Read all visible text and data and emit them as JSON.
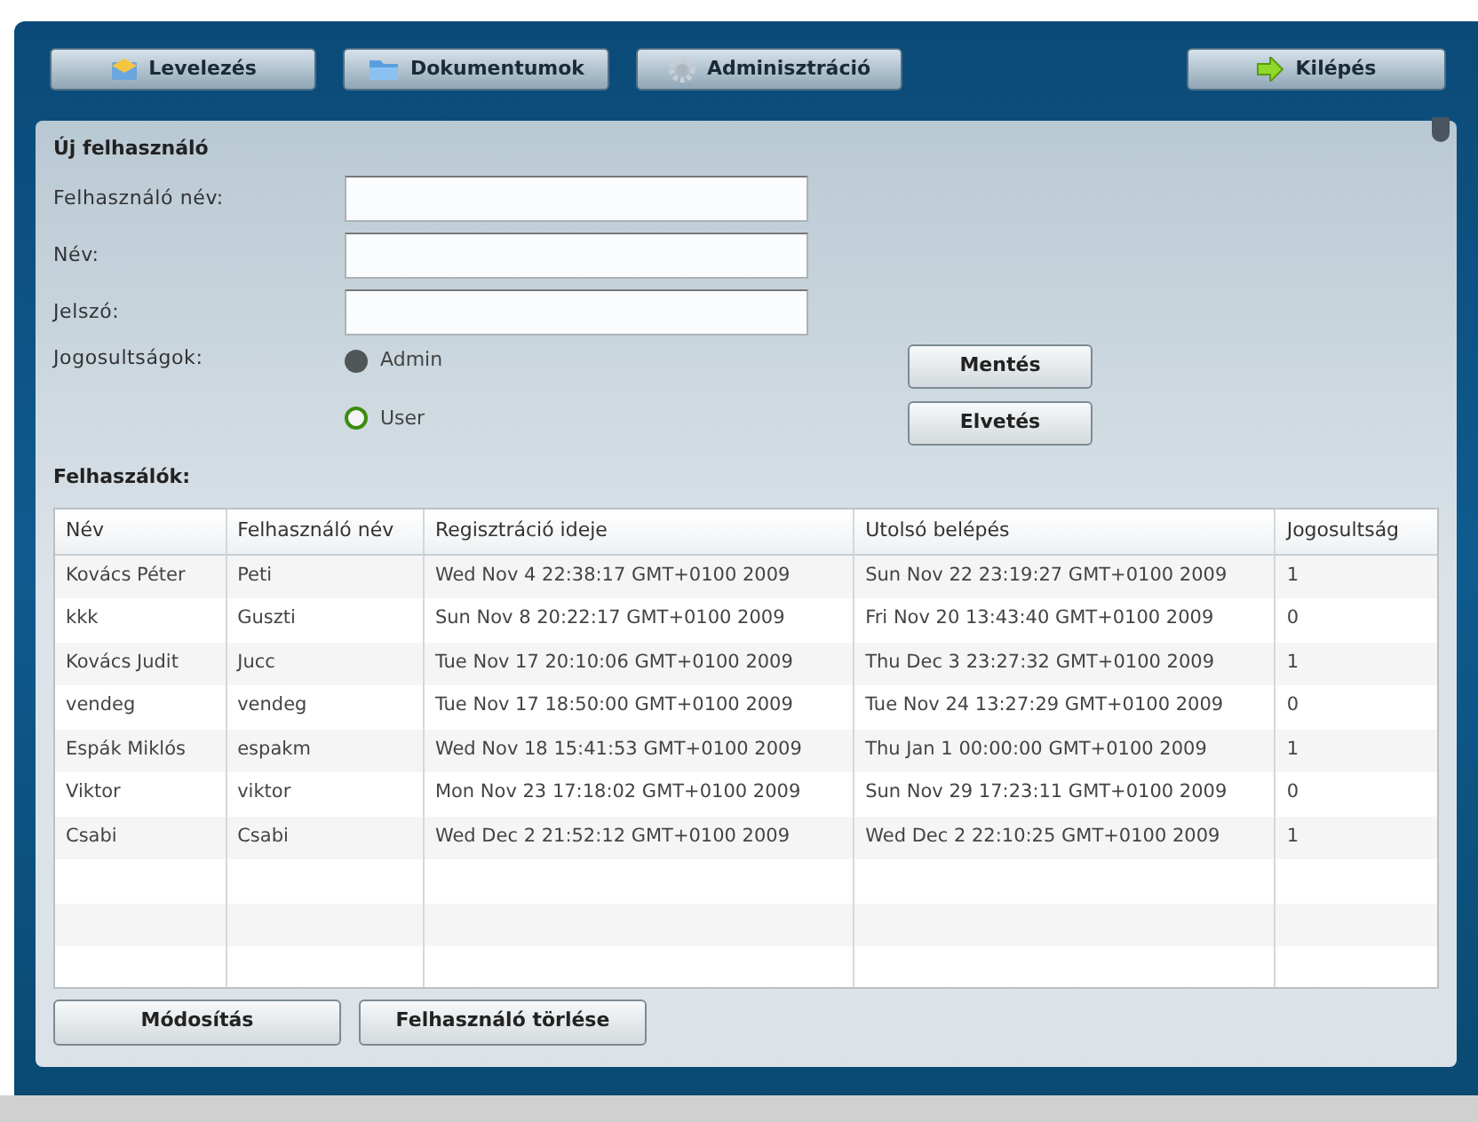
{
  "nav": [
    {
      "label": "Levelezés",
      "kind": "mail"
    },
    {
      "label": "Dokumentumok",
      "kind": "folder"
    },
    {
      "label": "Adminisztráció",
      "kind": "gear"
    },
    {
      "label": "Kilépés",
      "kind": "exit"
    }
  ],
  "panel": {
    "title": "Új felhasználó",
    "fields": [
      {
        "label": "Felhasználó név:"
      },
      {
        "label": "Név:"
      },
      {
        "label": "Jelszó:"
      }
    ],
    "rights_label": "Jogosultságok:",
    "radios": [
      {
        "label": "Admin",
        "selected": true
      },
      {
        "label": "User",
        "selected": false
      }
    ],
    "buttons": [
      "Mentés",
      "Elvetés"
    ],
    "users_label": "Felhaszálók:",
    "table": {
      "columns": [
        "Név",
        "Felhasználó név",
        "Regisztráció ideje",
        "Utolsó belépés",
        "Jogosultság"
      ],
      "rows": [
        [
          "Kovács Péter",
          "Peti",
          "Wed Nov 4 22:38:17 GMT+0100 2009",
          "Sun Nov 22 23:19:27 GMT+0100 2009",
          "1"
        ],
        [
          "kkk",
          "Guszti",
          "Sun Nov 8 20:22:17 GMT+0100 2009",
          "Fri Nov 20 13:43:40 GMT+0100 2009",
          "0"
        ],
        [
          "Kovács Judit",
          "Jucc",
          "Tue Nov 17 20:10:06 GMT+0100 2009",
          "Thu Dec 3 23:27:32 GMT+0100 2009",
          "1"
        ],
        [
          "vendeg",
          "vendeg",
          "Tue Nov 17 18:50:00 GMT+0100 2009",
          "Tue Nov 24 13:27:29 GMT+0100 2009",
          "0"
        ],
        [
          "Espák Miklós",
          "espakm",
          "Wed Nov 18 15:41:53 GMT+0100 2009",
          "Thu Jan 1 00:00:00 GMT+0100 2009",
          "1"
        ],
        [
          "Viktor",
          "viktor",
          "Mon Nov 23 17:18:02 GMT+0100 2009",
          "Sun Nov 29 17:23:11 GMT+0100 2009",
          "0"
        ],
        [
          "Csabi",
          "Csabi",
          "Wed Dec 2 21:52:12 GMT+0100 2009",
          "Wed Dec 2 22:10:25 GMT+0100 2009",
          "1"
        ]
      ]
    },
    "bottom_buttons": [
      "Módosítás",
      "Felhasználó törlése"
    ]
  }
}
